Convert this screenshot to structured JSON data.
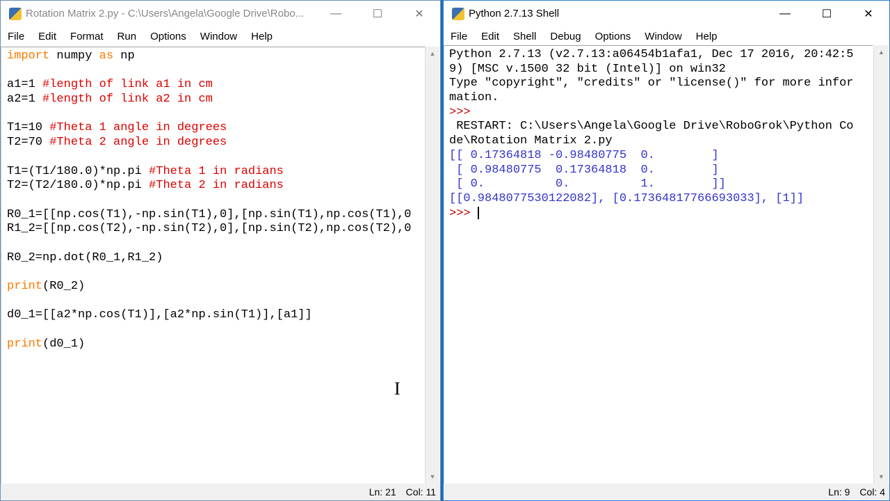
{
  "editor": {
    "title": "Rotation Matrix 2.py - C:\\Users\\Angela\\Google Drive\\Robo...",
    "menu": [
      "File",
      "Edit",
      "Format",
      "Run",
      "Options",
      "Window",
      "Help"
    ],
    "lines": [
      [
        {
          "t": "import",
          "c": "kw"
        },
        {
          "t": " numpy "
        },
        {
          "t": "as",
          "c": "kw"
        },
        {
          "t": " np"
        }
      ],
      [],
      [
        {
          "t": "a1=1 "
        },
        {
          "t": "#length of link a1 in cm",
          "c": "cm"
        }
      ],
      [
        {
          "t": "a2=1 "
        },
        {
          "t": "#length of link a2 in cm",
          "c": "cm"
        }
      ],
      [],
      [
        {
          "t": "T1=10 "
        },
        {
          "t": "#Theta 1 angle in degrees",
          "c": "cm"
        }
      ],
      [
        {
          "t": "T2=70 "
        },
        {
          "t": "#Theta 2 angle in degrees",
          "c": "cm"
        }
      ],
      [],
      [
        {
          "t": "T1=(T1/180.0)*np.pi "
        },
        {
          "t": "#Theta 1 in radians",
          "c": "cm"
        }
      ],
      [
        {
          "t": "T2=(T2/180.0)*np.pi "
        },
        {
          "t": "#Theta 2 in radians",
          "c": "cm"
        }
      ],
      [],
      [
        {
          "t": "R0_1=[[np.cos(T1),-np.sin(T1),0],[np.sin(T1),np.cos(T1),0"
        }
      ],
      [
        {
          "t": "R1_2=[[np.cos(T2),-np.sin(T2),0],[np.sin(T2),np.cos(T2),0"
        }
      ],
      [],
      [
        {
          "t": "R0_2=np.dot(R0_1,R1_2)"
        }
      ],
      [],
      [
        {
          "t": "print",
          "c": "kw"
        },
        {
          "t": "(R0_2)"
        }
      ],
      [],
      [
        {
          "t": "d0_1=[[a2*np.cos(T1)],[a2*np.sin(T1)],[a1]]"
        }
      ],
      [],
      [
        {
          "t": "print",
          "c": "kw"
        },
        {
          "t": "(d0_1)"
        }
      ]
    ],
    "status": {
      "ln": "Ln: 21",
      "col": "Col: 11"
    }
  },
  "shell": {
    "title": "Python 2.7.13 Shell",
    "menu": [
      "File",
      "Edit",
      "Shell",
      "Debug",
      "Options",
      "Window",
      "Help"
    ],
    "lines": [
      [
        {
          "t": "Python 2.7.13 (v2.7.13:a06454b1afa1, Dec 17 2016, 20:42:5"
        }
      ],
      [
        {
          "t": "9) [MSC v.1500 32 bit (Intel)] on win32"
        }
      ],
      [
        {
          "t": "Type \"copyright\", \"credits\" or \"license()\" for more infor"
        }
      ],
      [
        {
          "t": "mation."
        }
      ],
      [
        {
          "t": ">>> ",
          "c": "pr"
        }
      ],
      [
        {
          "t": " RESTART: C:\\Users\\Angela\\Google Drive\\RoboGrok\\Python Co"
        }
      ],
      [
        {
          "t": "de\\Rotation Matrix 2.py"
        }
      ],
      [
        {
          "t": "[[ 0.17364818 -0.98480775  0.        ]",
          "c": "out"
        }
      ],
      [
        {
          "t": " [ 0.98480775  0.17364818  0.        ]",
          "c": "out"
        }
      ],
      [
        {
          "t": " [ 0.          0.          1.        ]]",
          "c": "out"
        }
      ],
      [
        {
          "t": "[[0.9848077530122082], [0.17364817766693033], [1]]",
          "c": "out"
        }
      ],
      [
        {
          "t": ">>> ",
          "c": "pr"
        }
      ]
    ],
    "status": {
      "ln": "Ln: 9",
      "col": "Col: 4"
    }
  }
}
